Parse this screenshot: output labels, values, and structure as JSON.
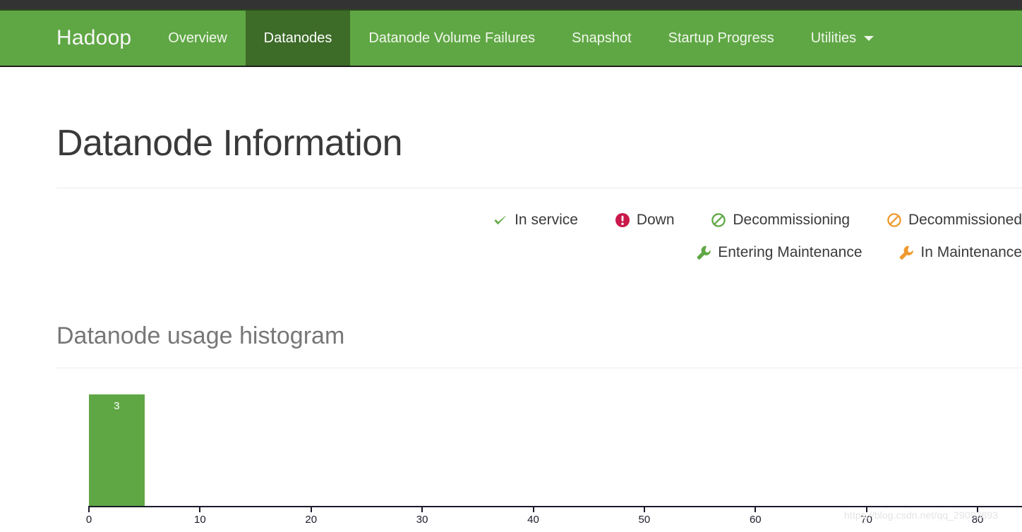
{
  "navbar": {
    "brand": "Hadoop",
    "items": [
      {
        "label": "Overview",
        "active": false,
        "caret": false
      },
      {
        "label": "Datanodes",
        "active": true,
        "caret": false
      },
      {
        "label": "Datanode Volume Failures",
        "active": false,
        "caret": false
      },
      {
        "label": "Snapshot",
        "active": false,
        "caret": false
      },
      {
        "label": "Startup Progress",
        "active": false,
        "caret": false
      },
      {
        "label": "Utilities",
        "active": false,
        "caret": true
      }
    ],
    "background_color": "#5fa744",
    "active_color": "#3d6b28",
    "topstrip_color": "#333333"
  },
  "page": {
    "title": "Datanode Information",
    "section_title": "Datanode usage histogram"
  },
  "legend": {
    "rows": [
      [
        {
          "icon": "check-icon",
          "label": "In service",
          "color": "#5fa744"
        },
        {
          "icon": "down-icon",
          "label": "Down",
          "color": "#c9184a"
        },
        {
          "icon": "ban-icon",
          "label": "Decommissioning",
          "color": "#5fa744"
        },
        {
          "icon": "ban-icon",
          "label": "Decommissioned",
          "color": "#f0992e"
        }
      ],
      [
        {
          "icon": "wrench-icon",
          "label": "Entering Maintenance",
          "color": "#5fa744"
        },
        {
          "icon": "wrench-icon",
          "label": "In Maintenance",
          "color": "#f0992e"
        }
      ]
    ]
  },
  "chart_data": {
    "type": "bar",
    "title": "Datanode usage histogram",
    "xlabel": "",
    "ylabel": "",
    "bar_color": "#5fa744",
    "xlim": [
      0,
      84
    ],
    "ylim": [
      0,
      3
    ],
    "xticks": [
      0,
      10,
      20,
      30,
      40,
      50,
      60,
      70,
      80
    ],
    "xtick_labels": [
      "0",
      "10",
      "20",
      "30",
      "40",
      "50",
      "60",
      "70",
      "80"
    ],
    "grid": false,
    "legend": "none",
    "bars": [
      {
        "x_start": 0,
        "x_end": 5,
        "value": 3,
        "label": "3"
      }
    ]
  },
  "watermark": {
    "text": "https://blog.csdn.net/qq_29093893"
  }
}
